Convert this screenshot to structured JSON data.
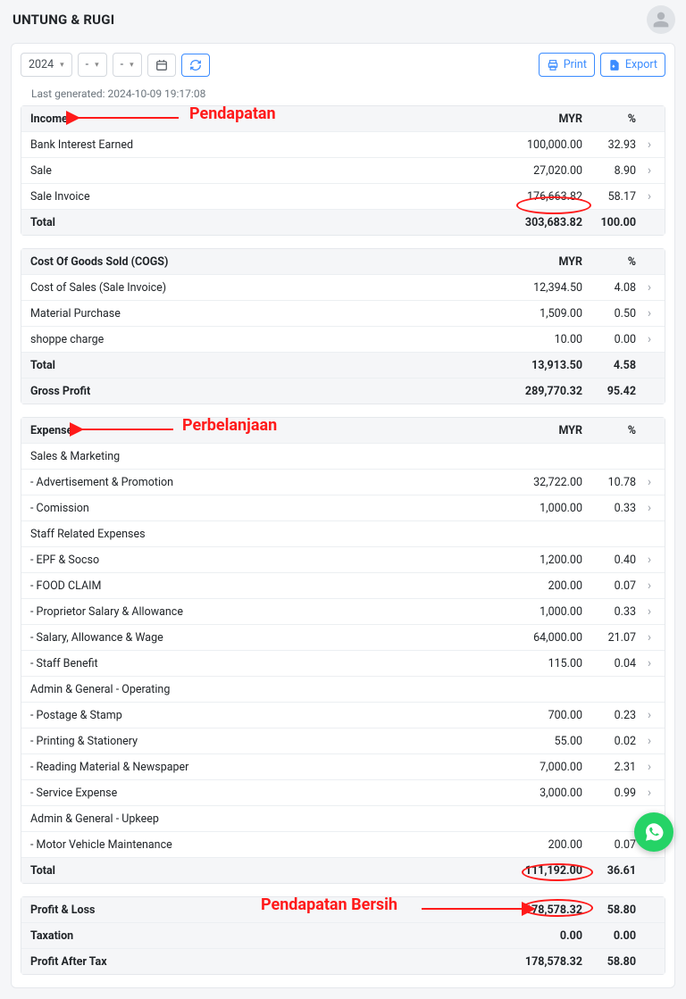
{
  "page_title": "UNTUNG & RUGI",
  "toolbar": {
    "year": "2024",
    "month": "-",
    "day": "-",
    "print_label": "Print",
    "export_label": "Export"
  },
  "last_generated_label": "Last generated: 2024-10-09 19:17:08",
  "col_myr": "MYR",
  "col_pct": "%",
  "annotations": {
    "pendapatan": "Pendapatan",
    "perbelanjaan": "Perbelanjaan",
    "pendapatan_bersih": "Pendapatan Bersih"
  },
  "income": {
    "header": "Income",
    "rows": [
      {
        "label": "Bank Interest Earned",
        "myr": "100,000.00",
        "pct": "32.93"
      },
      {
        "label": "Sale",
        "myr": "27,020.00",
        "pct": "8.90"
      },
      {
        "label": "Sale Invoice",
        "myr": "176,663.82",
        "pct": "58.17"
      }
    ],
    "total_label": "Total",
    "total_myr": "303,683.82",
    "total_pct": "100.00"
  },
  "cogs": {
    "header": "Cost Of Goods Sold (COGS)",
    "rows": [
      {
        "label": "Cost of Sales (Sale Invoice)",
        "myr": "12,394.50",
        "pct": "4.08"
      },
      {
        "label": "Material Purchase",
        "myr": "1,509.00",
        "pct": "0.50"
      },
      {
        "label": "shoppe charge",
        "myr": "10.00",
        "pct": "0.00"
      }
    ],
    "total_label": "Total",
    "total_myr": "13,913.50",
    "total_pct": "4.58",
    "gross_label": "Gross Profit",
    "gross_myr": "289,770.32",
    "gross_pct": "95.42"
  },
  "expense": {
    "header": "Expense",
    "groups": [
      {
        "title": "Sales & Marketing",
        "rows": [
          {
            "label": "- Advertisement & Promotion",
            "myr": "32,722.00",
            "pct": "10.78"
          },
          {
            "label": "- Comission",
            "myr": "1,000.00",
            "pct": "0.33"
          }
        ]
      },
      {
        "title": "Staff Related Expenses",
        "rows": [
          {
            "label": "- EPF & Socso",
            "myr": "1,200.00",
            "pct": "0.40"
          },
          {
            "label": "- FOOD CLAIM",
            "myr": "200.00",
            "pct": "0.07"
          },
          {
            "label": "- Proprietor Salary & Allowance",
            "myr": "1,000.00",
            "pct": "0.33"
          },
          {
            "label": "- Salary, Allowance & Wage",
            "myr": "64,000.00",
            "pct": "21.07"
          },
          {
            "label": "- Staff Benefit",
            "myr": "115.00",
            "pct": "0.04"
          }
        ]
      },
      {
        "title": "Admin & General - Operating",
        "rows": [
          {
            "label": "- Postage & Stamp",
            "myr": "700.00",
            "pct": "0.23"
          },
          {
            "label": "- Printing & Stationery",
            "myr": "55.00",
            "pct": "0.02"
          },
          {
            "label": "- Reading Material & Newspaper",
            "myr": "7,000.00",
            "pct": "2.31"
          },
          {
            "label": "- Service Expense",
            "myr": "3,000.00",
            "pct": "0.99"
          }
        ]
      },
      {
        "title": "Admin & General - Upkeep",
        "rows": [
          {
            "label": "- Motor Vehicle Maintenance",
            "myr": "200.00",
            "pct": "0.07"
          }
        ]
      }
    ],
    "total_label": "Total",
    "total_myr": "111,192.00",
    "total_pct": "36.61"
  },
  "pl": {
    "rows": [
      {
        "label": "Profit & Loss",
        "myr": "178,578.32",
        "pct": "58.80"
      },
      {
        "label": "Taxation",
        "myr": "0.00",
        "pct": "0.00"
      },
      {
        "label": "Profit After Tax",
        "myr": "178,578.32",
        "pct": "58.80"
      }
    ]
  }
}
